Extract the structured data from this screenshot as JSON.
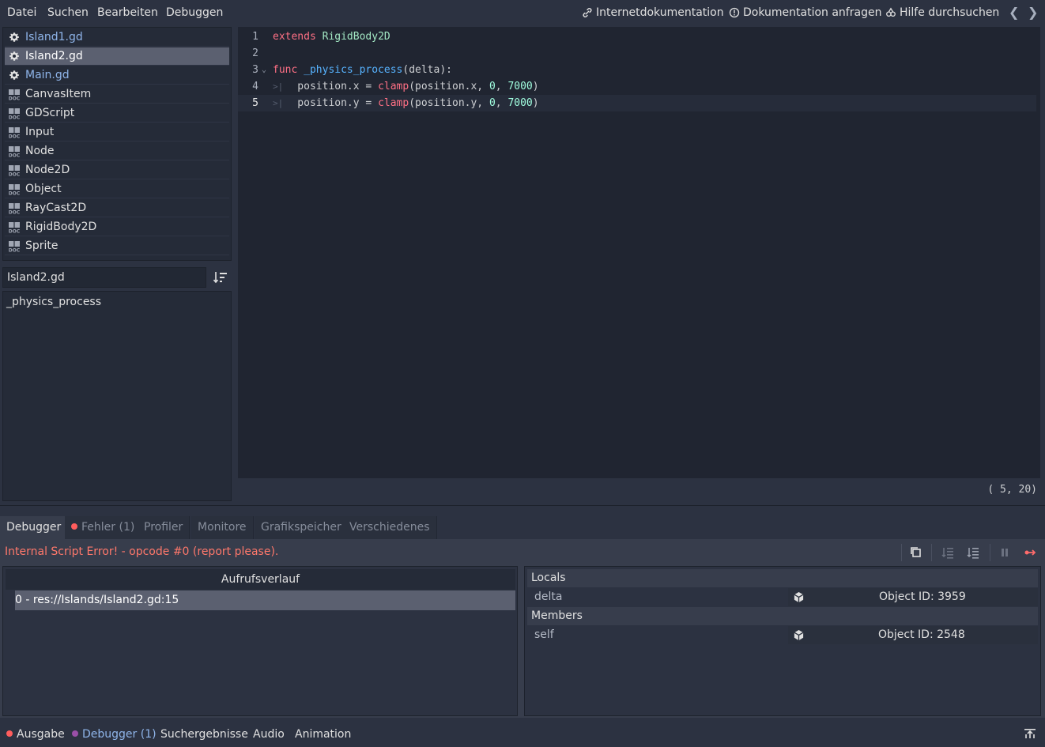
{
  "menubar": {
    "items": [
      "Datei",
      "Suchen",
      "Bearbeiten",
      "Debuggen"
    ],
    "help": {
      "online_docs": "Internetdokumentation",
      "request_docs": "Dokumentation anfragen",
      "search_help": "Hilfe durchsuchen"
    },
    "prev_arrow": "❮",
    "next_arrow": "❯"
  },
  "script_list": [
    {
      "label": "Island1.gd",
      "icon": "gear-icon",
      "kind": "script"
    },
    {
      "label": "Island2.gd",
      "icon": "gear-icon",
      "kind": "script",
      "selected": true
    },
    {
      "label": "Main.gd",
      "icon": "gear-icon",
      "kind": "script"
    },
    {
      "label": "CanvasItem",
      "icon": "doc-icon",
      "kind": "doc"
    },
    {
      "label": "GDScript",
      "icon": "doc-icon",
      "kind": "doc"
    },
    {
      "label": "Input",
      "icon": "doc-icon",
      "kind": "doc"
    },
    {
      "label": "Node",
      "icon": "doc-icon",
      "kind": "doc"
    },
    {
      "label": "Node2D",
      "icon": "doc-icon",
      "kind": "doc"
    },
    {
      "label": "Object",
      "icon": "doc-icon",
      "kind": "doc"
    },
    {
      "label": "RayCast2D",
      "icon": "doc-icon",
      "kind": "doc"
    },
    {
      "label": "RigidBody2D",
      "icon": "doc-icon",
      "kind": "doc"
    },
    {
      "label": "Sprite",
      "icon": "doc-icon",
      "kind": "doc"
    }
  ],
  "filter": {
    "value": "Island2.gd"
  },
  "methods": [
    "_physics_process"
  ],
  "editor": {
    "lines": [
      {
        "n": "1",
        "tokens": [
          {
            "t": "extends",
            "c": "kw"
          },
          {
            "t": " ",
            "c": "txt"
          },
          {
            "t": "RigidBody2D",
            "c": "ty"
          }
        ]
      },
      {
        "n": "2",
        "tokens": []
      },
      {
        "n": "3",
        "fold": "⌄",
        "tokens": [
          {
            "t": "func",
            "c": "kw"
          },
          {
            "t": " ",
            "c": "txt"
          },
          {
            "t": "_physics_process",
            "c": "fn"
          },
          {
            "t": "(delta):",
            "c": "txt"
          }
        ]
      },
      {
        "n": "4",
        "tab": ">|",
        "tokens": [
          {
            "t": "    position.x = ",
            "c": "txt"
          },
          {
            "t": "clamp",
            "c": "bi"
          },
          {
            "t": "(position.x, ",
            "c": "txt"
          },
          {
            "t": "0",
            "c": "num"
          },
          {
            "t": ", ",
            "c": "txt"
          },
          {
            "t": "7000",
            "c": "num"
          },
          {
            "t": ")",
            "c": "txt"
          }
        ]
      },
      {
        "n": "5",
        "tab": ">|",
        "current": true,
        "tokens": [
          {
            "t": "    position.y = ",
            "c": "txt"
          },
          {
            "t": "clamp",
            "c": "bi"
          },
          {
            "t": "(position.y, ",
            "c": "txt"
          },
          {
            "t": "0",
            "c": "num"
          },
          {
            "t": ", ",
            "c": "txt"
          },
          {
            "t": "7000",
            "c": "num"
          },
          {
            "t": ")",
            "c": "txt"
          }
        ]
      }
    ],
    "cursor_pos": "(  5, 20)"
  },
  "debugger": {
    "tabs": [
      {
        "label": "Debugger",
        "active": true
      },
      {
        "label": "Fehler (1)",
        "dot": true
      },
      {
        "label": "Profiler"
      },
      {
        "label": "Monitore"
      },
      {
        "label": "Grafikspeicher"
      },
      {
        "label": "Verschiedenes"
      }
    ],
    "error": "Internal Script Error! - opcode #0 (report please).",
    "callstack_header": "Aufrufsverlauf",
    "callstack": [
      "0 - res://Islands/Island2.gd:15"
    ],
    "inspector": {
      "locals_label": "Locals",
      "members_label": "Members",
      "locals": [
        {
          "name": "delta",
          "value": "Object ID: 3959"
        }
      ],
      "members": [
        {
          "name": "self",
          "value": "Object ID: 2548"
        }
      ]
    }
  },
  "bottombar": {
    "tabs": [
      {
        "label": "Ausgabe",
        "dot": "red"
      },
      {
        "label": "Debugger (1)",
        "dot": "purple",
        "active": true
      },
      {
        "label": "Suchergebnisse"
      },
      {
        "label": "Audio"
      },
      {
        "label": "Animation"
      }
    ]
  },
  "colors": {
    "accent": "#8fb5ea",
    "error": "#ff786b",
    "background": "#2c3241"
  }
}
